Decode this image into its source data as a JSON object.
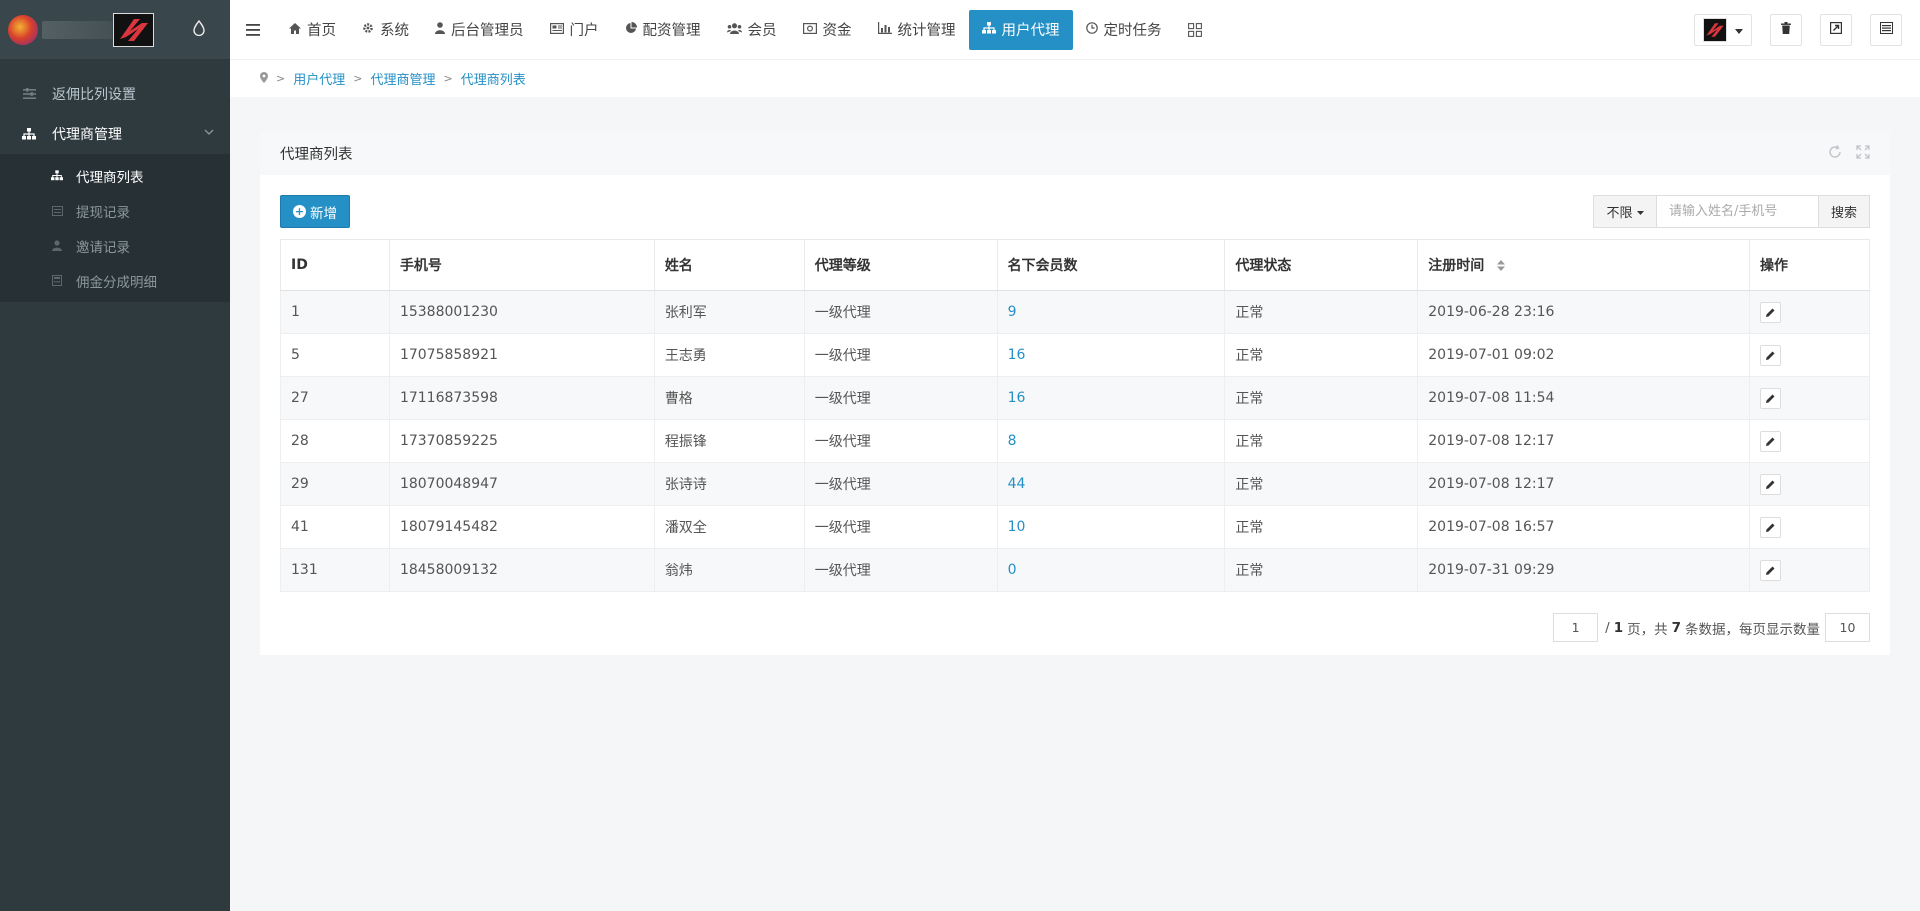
{
  "sidebar": {
    "items": [
      {
        "label": "返佣比列设置"
      },
      {
        "label": "代理商管理"
      }
    ],
    "sub_items": [
      {
        "label": "代理商列表"
      },
      {
        "label": "提现记录"
      },
      {
        "label": "邀请记录"
      },
      {
        "label": "佣金分成明细"
      }
    ]
  },
  "topbar": {
    "menu": [
      {
        "label": "首页",
        "icon": "home-icon"
      },
      {
        "label": "系统",
        "icon": "gear-icon"
      },
      {
        "label": "后台管理员",
        "icon": "user-icon"
      },
      {
        "label": "门户",
        "icon": "newspaper-icon"
      },
      {
        "label": "配资管理",
        "icon": "pie-chart-icon"
      },
      {
        "label": "会员",
        "icon": "users-icon"
      },
      {
        "label": "资金",
        "icon": "money-icon"
      },
      {
        "label": "统计管理",
        "icon": "bar-chart-icon"
      },
      {
        "label": "用户代理",
        "icon": "sitemap-icon"
      },
      {
        "label": "定时任务",
        "icon": "clock-icon"
      }
    ],
    "active_index": 8,
    "accent_color": "#2590c5"
  },
  "breadcrumb": [
    "用户代理",
    "代理商管理",
    "代理商列表"
  ],
  "panel": {
    "title": "代理商列表",
    "add_label": "新增",
    "search": {
      "filter_label": "不限",
      "placeholder": "请输入姓名/手机号",
      "button_label": "搜索"
    }
  },
  "table": {
    "columns": [
      "ID",
      "手机号",
      "姓名",
      "代理等级",
      "名下会员数",
      "代理状态",
      "注册时间",
      "操作"
    ],
    "rows": [
      {
        "id": "1",
        "phone": "15388001230",
        "name": "张利军",
        "level": "一级代理",
        "members": "9",
        "status": "正常",
        "registered": "2019-06-28 23:16"
      },
      {
        "id": "5",
        "phone": "17075858921",
        "name": "王志勇",
        "level": "一级代理",
        "members": "16",
        "status": "正常",
        "registered": "2019-07-01 09:02"
      },
      {
        "id": "27",
        "phone": "17116873598",
        "name": "曹格",
        "level": "一级代理",
        "members": "16",
        "status": "正常",
        "registered": "2019-07-08 11:54"
      },
      {
        "id": "28",
        "phone": "17370859225",
        "name": "程振锋",
        "level": "一级代理",
        "members": "8",
        "status": "正常",
        "registered": "2019-07-08 12:17"
      },
      {
        "id": "29",
        "phone": "18070048947",
        "name": "张诗诗",
        "level": "一级代理",
        "members": "44",
        "status": "正常",
        "registered": "2019-07-08 12:17"
      },
      {
        "id": "41",
        "phone": "18079145482",
        "name": "潘双全",
        "level": "一级代理",
        "members": "10",
        "status": "正常",
        "registered": "2019-07-08 16:57"
      },
      {
        "id": "131",
        "phone": "18458009132",
        "name": "翁炜",
        "level": "一级代理",
        "members": "0",
        "status": "正常",
        "registered": "2019-07-31 09:29"
      }
    ]
  },
  "pagination": {
    "current_page": "1",
    "sep": "/",
    "total_pages": "1",
    "page_word": "页，共",
    "total_count": "7",
    "tail_text": "条数据，每页显示数量",
    "page_size": "10"
  }
}
